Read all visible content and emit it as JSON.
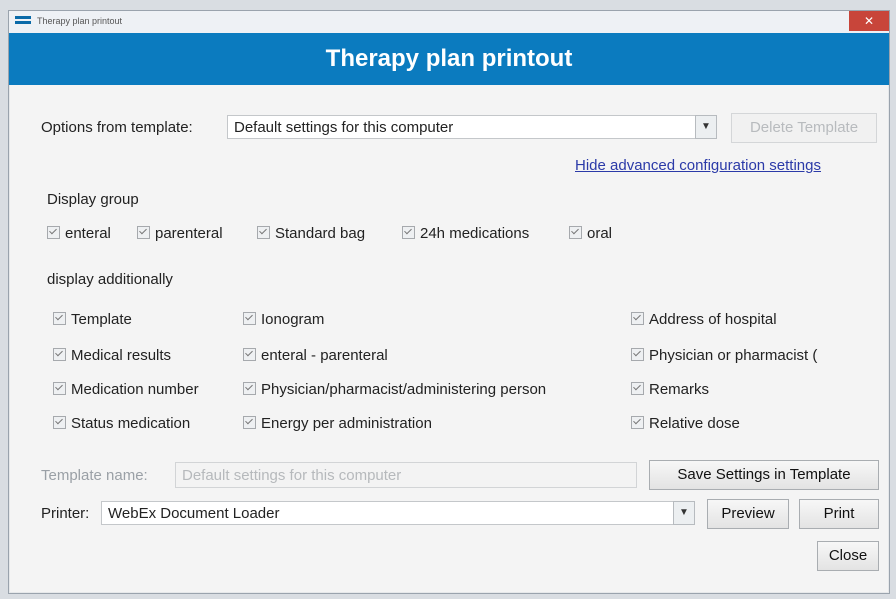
{
  "window": {
    "title": "Therapy plan printout",
    "close_glyph": "✕"
  },
  "header": {
    "title": "Therapy plan printout"
  },
  "options": {
    "label": "Options from template:",
    "selected": "Default settings for this computer",
    "delete_button": "Delete Template"
  },
  "advanced_link": "Hide advanced configuration settings",
  "display_group": {
    "label": "Display group",
    "items": [
      {
        "label": "enteral",
        "checked": true
      },
      {
        "label": "parenteral",
        "checked": true
      },
      {
        "label": "Standard bag",
        "checked": true
      },
      {
        "label": "24h medications",
        "checked": true
      },
      {
        "label": "oral",
        "checked": true
      }
    ]
  },
  "display_additionally": {
    "label": "display additionally",
    "col1": [
      {
        "label": "Template",
        "checked": true
      },
      {
        "label": "Medical results",
        "checked": true
      },
      {
        "label": "Medication number",
        "checked": true
      },
      {
        "label": "Status medication",
        "checked": true
      }
    ],
    "col2": [
      {
        "label": "Ionogram",
        "checked": true
      },
      {
        "label": "enteral - parenteral",
        "checked": true
      },
      {
        "label": "Physician/pharmacist/administering person",
        "checked": true
      },
      {
        "label": "Energy per administration",
        "checked": true
      }
    ],
    "col3": [
      {
        "label": "Address of hospital",
        "checked": true
      },
      {
        "label": "Physician or pharmacist (",
        "checked": true
      },
      {
        "label": "Remarks",
        "checked": true
      },
      {
        "label": "Relative dose",
        "checked": true
      }
    ]
  },
  "template_name": {
    "label": "Template name:",
    "value": "Default settings for this computer",
    "save_button": "Save Settings in Template"
  },
  "printer": {
    "label": "Printer:",
    "selected": "WebEx Document Loader",
    "preview_button": "Preview",
    "print_button": "Print"
  },
  "close_button": "Close",
  "icons": {
    "dropdown": "chevron-down-icon",
    "checkbox": "checkmark-icon"
  },
  "colors": {
    "header": "#0b7bbf",
    "link": "#2b3aa8",
    "close": "#c8453a"
  }
}
